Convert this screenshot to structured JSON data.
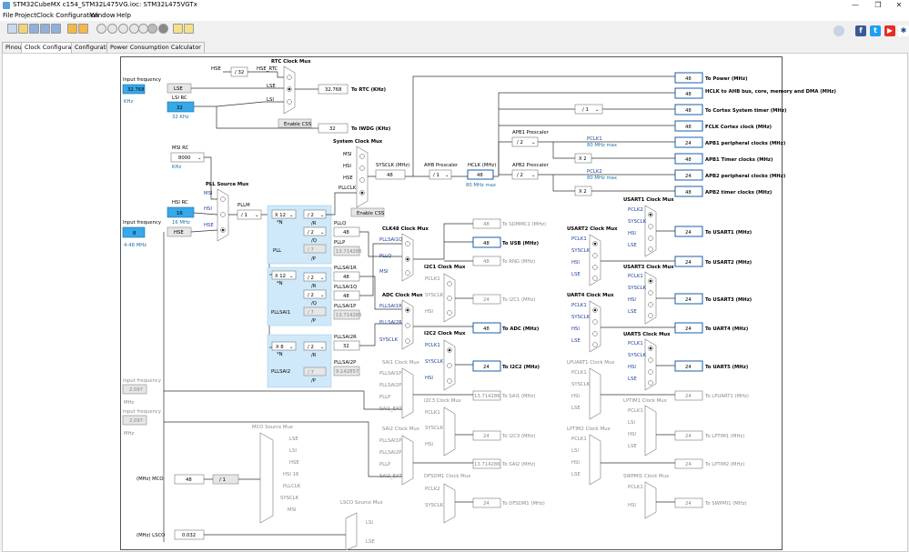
{
  "window": {
    "title": "STM32CubeMX c154_STM32L475VG.ioc: STM32L475VGTx",
    "minimize": "—",
    "restore": "❐",
    "close": "✕"
  },
  "menu": [
    "File",
    "Project",
    "Clock Configuration",
    "Window",
    "Help"
  ],
  "tabs": [
    "Pinout",
    "Clock Configuration",
    "Configuration",
    "Power Consumption Calculator"
  ],
  "social": {
    "facebook": "f",
    "twitter": "t",
    "youtube": "▶"
  },
  "left": {
    "input_freq_label": "Input frequency",
    "lse_value": "32.768",
    "khz": "KHz",
    "lse": "LSE",
    "lsi_rc": "LSI RC",
    "lsi_value": "32",
    "lsi_unit": "32 KHz",
    "msi_rc": "MSI RC",
    "msi_value": "8000",
    "hsi_rc": "HSI RC",
    "hsi_value": "16",
    "hsi_unit": "16 MHz",
    "hse_input_label": "Input frequency",
    "hse_value": "8",
    "hse": "HSE",
    "hse_range": "4-48 MHz",
    "in_freq1_label": "Input frequency",
    "in_freq1_value": "2.097",
    "in_freq1_unit": "MHz",
    "in_freq2_label": "Input frequency",
    "in_freq2_value": "2.097",
    "in_freq2_unit": "MHz",
    "mco_label": "(MHz) MCO",
    "mco_value": "48",
    "mco_div": "/ 1",
    "lsco_label": "(MHz) LSCO",
    "lsco_value": "0.032"
  },
  "rtc": {
    "hse": "HSE",
    "div32": "/ 32",
    "hse_rtc": "HSE_RTC",
    "title": "RTC Clock Mux",
    "lse": "LSE",
    "lsi": "LSI",
    "value": "32.768",
    "to": "To RTC (KHz)",
    "enable_css": "Enable CSS",
    "iwdg_value": "32",
    "iwdg_to": "To IWDG (KHz)"
  },
  "sysmux": {
    "title": "System Clock Mux",
    "msi": "MSI",
    "hsi": "HSI",
    "hse": "HSE",
    "pllclk": "PLLCLK",
    "enable_css": "Enable CSS",
    "sysclk_label": "SYSCLK (MHz)",
    "sysclk_value": "48",
    "ahb_label": "AHB Prescaler",
    "ahb_value": "/ 1",
    "hclk_label": "HCLK (MHz)",
    "hclk_value": "48",
    "hclk_max": "80 MHz max"
  },
  "pll": {
    "source_title": "PLL Source Mux",
    "msi": "MSI",
    "hsi": "HSI",
    "hse": "HSE",
    "pllm_label": "PLLM",
    "pllm_value": "/ 1",
    "pll_label": "PLL",
    "n_value": "X 12",
    "r_value": "/ 2",
    "q_value": "/ 2",
    "p_value": "/ 7",
    "n_sub": "*N",
    "r_sub": "/R",
    "q_sub": "/Q",
    "p_sub": "/P",
    "pllq_label": "PLLQ",
    "pllq_value": "48",
    "pllp_label": "PLLP",
    "pllp_value": "13.714286",
    "sai1_label": "PLLSAI1",
    "sai1_n": "X 12",
    "sai1_r": "/ 2",
    "sai1_q": "/ 2",
    "sai1_p": "/ 7",
    "sai1r_label": "PLLSAI1R",
    "sai1r_value": "48",
    "sai1q_label": "PLLSAI1Q",
    "sai1q_value": "48",
    "sai1p_label": "PLLSAI1P",
    "sai1p_value": "13.714286",
    "sai2_label": "PLLSAI2",
    "sai2_n": "X 8",
    "sai2_r": "/ 2",
    "sai2_p": "/ 7",
    "sai2r_label": "PLLSAI2R",
    "sai2r_value": "32",
    "sai2p_label": "PLLSAI2P",
    "sai2p_value": "9.142857"
  },
  "outputs": {
    "power_value": "48",
    "power_label": "To Power (MHz)",
    "hclk_value": "48",
    "hclk_label": "HCLK to AHB bus, core, memory and DMA (MHz)",
    "cortex_div": "/ 1",
    "cortex_value": "48",
    "cortex_label": "To Cortex System timer (MHz)",
    "fclk_value": "48",
    "fclk_label": "FCLK Cortex clock (MHz)",
    "apb1_label": "APB1 Prescaler",
    "apb1_div": "/ 2",
    "pclk1": "PCLK1",
    "pclk1_max": "80 MHz max",
    "apb1p_value": "24",
    "apb1p_label": "APB1 peripheral clocks (MHz)",
    "x2a": "X 2",
    "apb1t_value": "48",
    "apb1t_label": "APB1 Timer clocks (MHz)",
    "apb2_label": "APB2 Prescaler",
    "apb2_div": "/ 2",
    "pclk2": "PCLK2",
    "pclk2_max": "80 MHz max",
    "apb2p_value": "24",
    "apb2p_label": "APB2 peripheral clocks (MHz)",
    "x2b": "X 2",
    "apb2t_value": "48",
    "apb2t_label": "APB2 timer clocks (MHz)"
  },
  "clk48": {
    "title": "CLK48 Clock Mux",
    "pllsai1q": "PLLSAI1Q",
    "pllq": "PLLQ",
    "msi": "MSI",
    "sdmmc_value": "48",
    "sdmmc_label": "To SDMMC1 (MHz)",
    "usb_value": "48",
    "usb_label": "To USB (MHz)",
    "rng_value": "48",
    "rng_label": "To RNG (MHz)"
  },
  "i2c1": {
    "title": "I2C1 Clock Mux",
    "pclk1": "PCLK1",
    "sysclk": "SYSCLK",
    "hsi": "HSI",
    "value": "24",
    "label": "To I2C1 (MHz)"
  },
  "adc": {
    "title": "ADC Clock Mux",
    "pllsai1r": "PLLSAI1R",
    "pllsai2r": "PLLSAI2R",
    "sysclk": "SYSCLK",
    "value": "48",
    "label": "To ADC (MHz)"
  },
  "i2c2": {
    "title": "I2C2 Clock Mux",
    "pclk1": "PCLK1",
    "sysclk": "SYSCLK",
    "hsi": "HSI",
    "value": "24",
    "label": "To I2C2 (MHz)"
  },
  "sai1": {
    "title": "SAI1 Clock Mux",
    "pllsai1p": "PLLSAI1P",
    "pllsai2p": "PLLSAI2P",
    "pllp": "PLLP",
    "ext": "SAI1_EXT",
    "value": "13.714286",
    "label": "To SAI1 (MHz)"
  },
  "i2c3": {
    "title": "I2C3 Clock Mux",
    "pclk1": "PCLK1",
    "sysclk": "SYSCLK",
    "hsi": "HSI",
    "value": "24",
    "label": "To I2C3 (MHz)"
  },
  "sai2": {
    "title": "SAI2 Clock Mux",
    "pllsai1p": "PLLSAI1P",
    "pllsai2p": "PLLSAI2P",
    "pllp": "PLLP",
    "ext": "SAI2_EXT",
    "value": "13.714286",
    "label": "To SAI2 (MHz)"
  },
  "dfsdm": {
    "title": "DFSDM1 Clock Mux",
    "pclk2": "PCLK2",
    "sysclk": "SYSCLK",
    "value": "24",
    "label": "To DFSDM1 (MHz)"
  },
  "mco": {
    "title": "MCO Source Mux",
    "lse": "LSE",
    "lsi": "LSI",
    "hse": "HSE",
    "hsi16": "HSI 16",
    "pllclk": "PLLCLK",
    "sysclk": "SYSCLK",
    "msi": "MSI"
  },
  "lsco": {
    "title": "LSCO Source Mux",
    "lsi": "LSI",
    "lse": "LSE"
  },
  "usart1": {
    "title": "USART1 Clock Mux",
    "pclk2": "PCLK2",
    "sysclk": "SYSCLK",
    "hsi": "HSI",
    "lse": "LSE",
    "value": "24",
    "label": "To USART1 (MHz)"
  },
  "usart2": {
    "title": "USART2 Clock Mux",
    "pclk1": "PCLK1",
    "sysclk": "SYSCLK",
    "hsi": "HSI",
    "lse": "LSE",
    "value": "24",
    "label": "To USART2 (MHz)"
  },
  "usart3": {
    "title": "USART3 Clock Mux",
    "pclk1": "PCLK1",
    "sysclk": "SYSCLK",
    "hsi": "HSI",
    "lse": "LSE",
    "value": "24",
    "label": "To USART3 (MHz)"
  },
  "uart4": {
    "title": "UART4 Clock Mux",
    "pclk1": "PCLK1",
    "sysclk": "SYSCLK",
    "hsi": "HSI",
    "lse": "LSE",
    "value": "24",
    "label": "To UART4 (MHz)"
  },
  "uart5": {
    "title": "UART5 Clock Mux",
    "pclk1": "PCLK1",
    "sysclk": "SYSCLK",
    "hsi": "HSI",
    "lse": "LSE",
    "value": "24",
    "label": "To UART5 (MHz)"
  },
  "lpuart1": {
    "title": "LPUART1 Clock Mux",
    "pclk1": "PCLK1",
    "sysclk": "SYSCLK",
    "hsi": "HSI",
    "lse": "LSE",
    "value": "24",
    "label": "To LPUART1 (MHz)"
  },
  "lptim1": {
    "title": "LPTIM1 Clock Mux",
    "pclk1": "PCLK1",
    "lsi": "LSI",
    "hsi": "HSI",
    "lse": "LSE",
    "value": "24",
    "label": "To LPTIM1 (MHz)"
  },
  "lptim2": {
    "title": "LPTIM2 Clock Mux",
    "pclk1": "PCLK1",
    "lsi": "LSI",
    "hsi": "HSI",
    "lse": "LSE",
    "value": "24",
    "label": "To LPTIM2 (MHz)"
  },
  "swpmi": {
    "title": "SWPMI1 Clock Mux",
    "pclk1": "PCLK1",
    "hsi": "HSI",
    "value": "24",
    "label": "To SWPMI1 (MHz)"
  }
}
